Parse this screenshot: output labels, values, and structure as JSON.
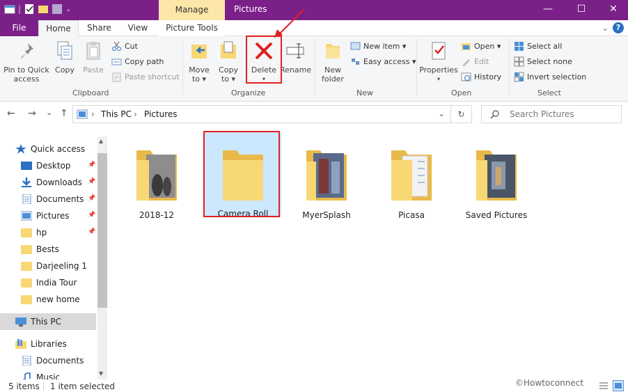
{
  "window": {
    "title": "Pictures",
    "context_tab": "Manage",
    "minimize": "—",
    "maximize": "☐",
    "close": "✕"
  },
  "tabs": {
    "file": "File",
    "home": "Home",
    "share": "Share",
    "view": "View",
    "picture_tools": "Picture Tools",
    "help": "?"
  },
  "ribbon": {
    "clipboard": {
      "pin": "Pin to Quick access",
      "pin_line1": "Pin to Quick",
      "pin_line2": "access",
      "copy": "Copy",
      "paste": "Paste",
      "cut": "Cut",
      "copy_path": "Copy path",
      "paste_shortcut": "Paste shortcut",
      "label": "Clipboard"
    },
    "organize": {
      "move_to": "Move",
      "move_to2": "to ▾",
      "copy_to": "Copy",
      "copy_to2": "to ▾",
      "delete": "Delete",
      "delete_arrow": "▾",
      "rename": "Rename",
      "label": "Organize"
    },
    "new": {
      "new_folder": "New",
      "new_folder2": "folder",
      "new_item": "New item ▾",
      "easy_access": "Easy access ▾",
      "label": "New"
    },
    "open": {
      "properties": "Properties",
      "properties_arrow": "▾",
      "open": "Open ▾",
      "edit": "Edit",
      "history": "History",
      "label": "Open"
    },
    "select": {
      "select_all": "Select all",
      "select_none": "Select none",
      "invert": "Invert selection",
      "label": "Select"
    }
  },
  "navigation": {
    "back": "←",
    "forward": "→",
    "recent": "⌄",
    "up": "↑",
    "path": [
      "This PC",
      "Pictures"
    ],
    "separator": "›",
    "dropdown": "⌄",
    "refresh": "↻",
    "search_placeholder": "Search Pictures"
  },
  "sidebar": {
    "quick_access": "Quick access",
    "items": [
      {
        "label": "Desktop",
        "icon": "desktop-icon",
        "pinned": true
      },
      {
        "label": "Downloads",
        "icon": "downloads-icon",
        "pinned": true
      },
      {
        "label": "Documents",
        "icon": "documents-icon",
        "pinned": true
      },
      {
        "label": "Pictures",
        "icon": "pictures-icon",
        "pinned": true
      },
      {
        "label": "hp",
        "icon": "folder-icon",
        "pinned": true
      },
      {
        "label": "Bests",
        "icon": "folder-icon",
        "pinned": false
      },
      {
        "label": "Darjeeling 1",
        "icon": "folder-icon",
        "pinned": false
      },
      {
        "label": "India Tour",
        "icon": "folder-icon",
        "pinned": false
      },
      {
        "label": "new home",
        "icon": "folder-icon",
        "pinned": false
      }
    ],
    "this_pc": "This PC",
    "libraries": "Libraries",
    "lib_items": [
      {
        "label": "Documents",
        "icon": "documents-icon"
      },
      {
        "label": "Music",
        "icon": "music-icon"
      }
    ]
  },
  "folders": [
    {
      "name": "2018-12",
      "selected": false
    },
    {
      "name": "Camera Roll",
      "selected": true
    },
    {
      "name": "MyerSplash",
      "selected": false
    },
    {
      "name": "Picasa",
      "selected": false
    },
    {
      "name": "Saved Pictures",
      "selected": false
    }
  ],
  "status": {
    "items": "5 items",
    "selected": "1 item selected"
  },
  "watermark": "©Howtoconnect",
  "colors": {
    "accent": "#7b2089",
    "context_tab": "#fce7a8",
    "selection": "#cce8ff",
    "highlight_box": "#e02020",
    "folder": "#f8d775"
  }
}
